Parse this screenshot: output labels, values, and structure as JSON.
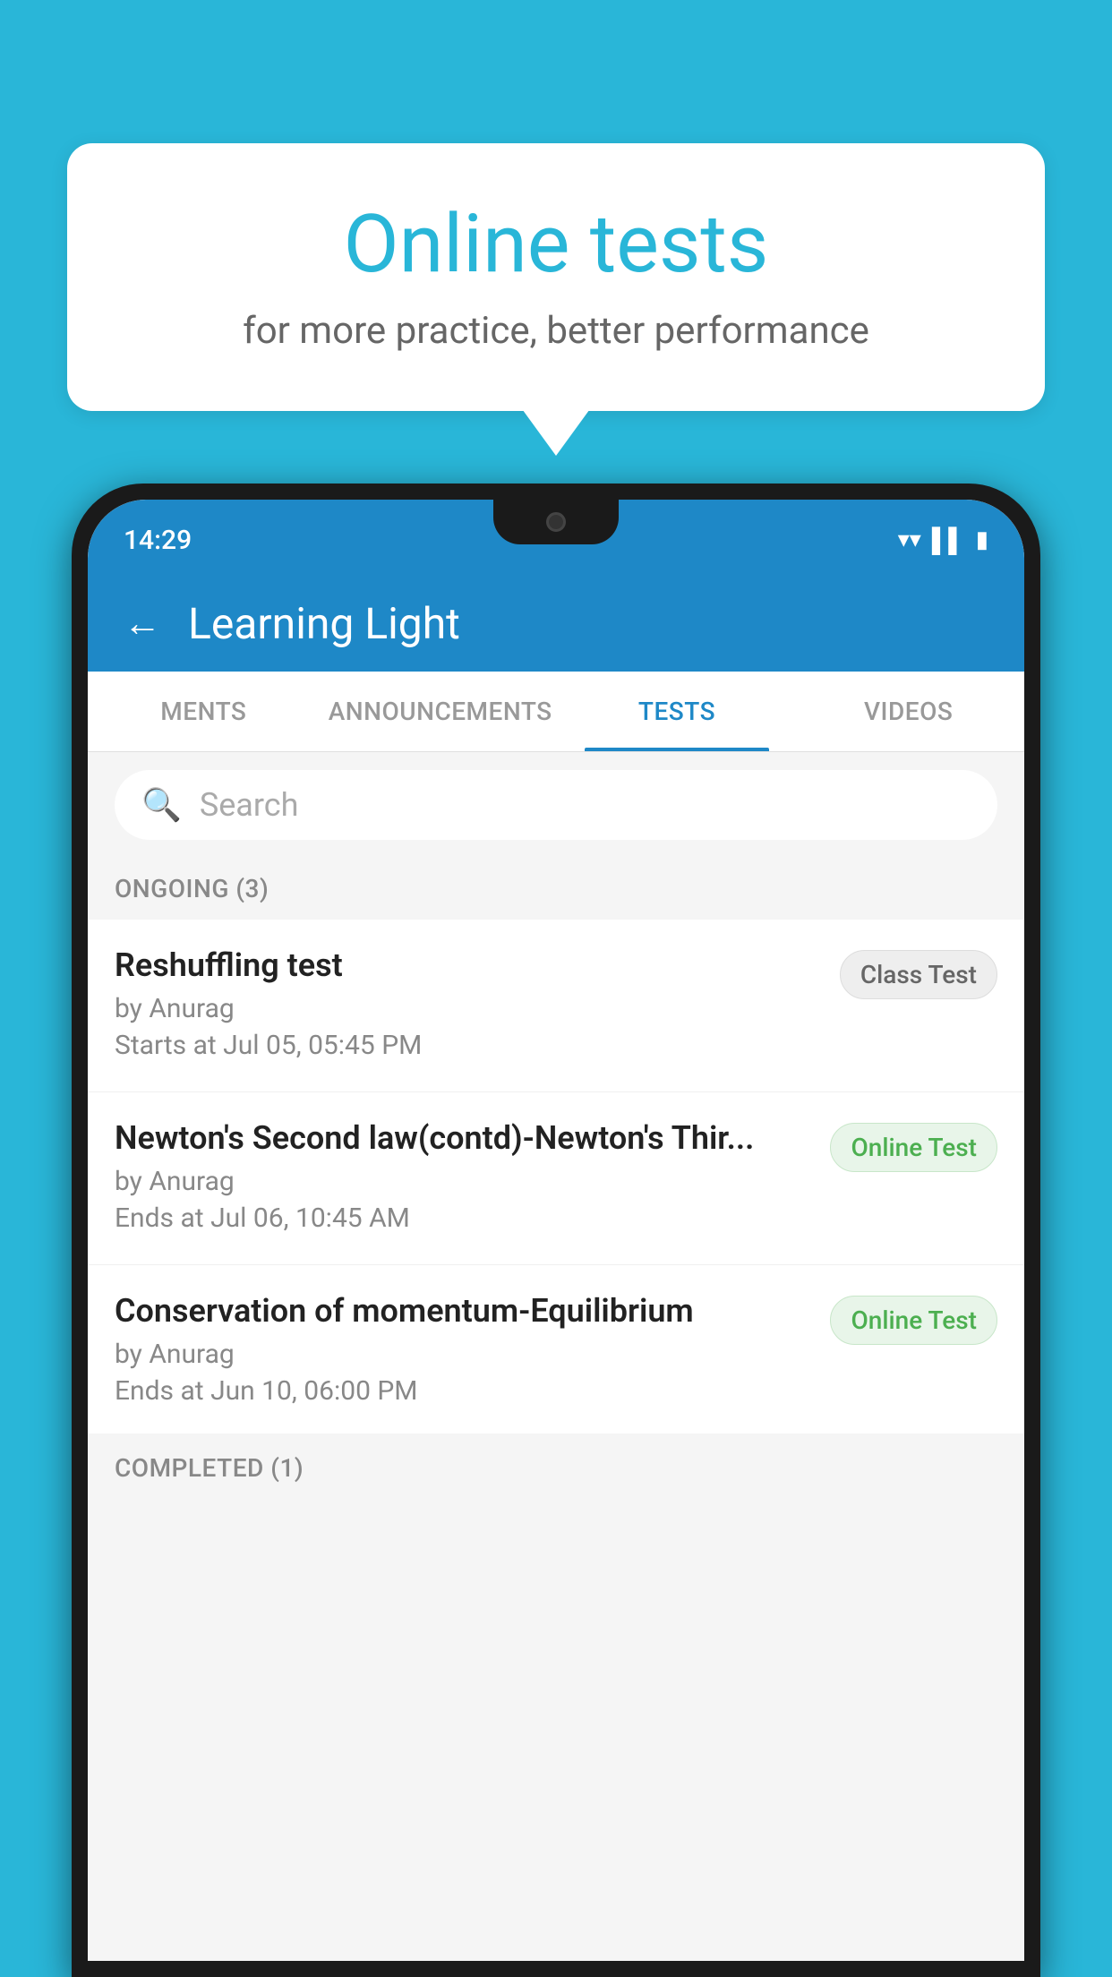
{
  "background_color": "#29b6d8",
  "speech_bubble": {
    "title": "Online tests",
    "subtitle": "for more practice, better performance"
  },
  "phone": {
    "status_bar": {
      "time": "14:29",
      "icons": [
        "wifi",
        "signal",
        "battery"
      ]
    },
    "app_header": {
      "back_label": "←",
      "title": "Learning Light"
    },
    "tabs": [
      {
        "label": "MENTS",
        "active": false
      },
      {
        "label": "ANNOUNCEMENTS",
        "active": false
      },
      {
        "label": "TESTS",
        "active": true
      },
      {
        "label": "VIDEOS",
        "active": false
      }
    ],
    "search": {
      "placeholder": "Search"
    },
    "sections": [
      {
        "header": "ONGOING (3)",
        "items": [
          {
            "name": "Reshuffling test",
            "author": "by Anurag",
            "time_label": "Starts at",
            "time": "Jul 05, 05:45 PM",
            "badge": "Class Test",
            "badge_type": "class"
          },
          {
            "name": "Newton's Second law(contd)-Newton's Thir...",
            "author": "by Anurag",
            "time_label": "Ends at",
            "time": "Jul 06, 10:45 AM",
            "badge": "Online Test",
            "badge_type": "online"
          },
          {
            "name": "Conservation of momentum-Equilibrium",
            "author": "by Anurag",
            "time_label": "Ends at",
            "time": "Jun 10, 06:00 PM",
            "badge": "Online Test",
            "badge_type": "online"
          }
        ]
      }
    ],
    "completed_header": "COMPLETED (1)"
  }
}
